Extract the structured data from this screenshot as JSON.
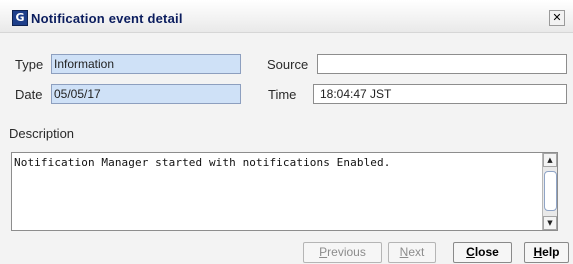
{
  "window": {
    "title": "Notification event detail",
    "title_icon_glyph": "G",
    "close_glyph": "✕"
  },
  "form": {
    "type_label": "Type",
    "type_value": "Information",
    "source_label": "Source",
    "source_value": "",
    "date_label": "Date",
    "date_value": "05/05/17",
    "time_label": "Time",
    "time_value": "18:04:47 JST"
  },
  "description": {
    "label": "Description",
    "text": "Notification Manager started with notifications Enabled."
  },
  "buttons": {
    "previous": {
      "mnemonic": "P",
      "rest": "revious",
      "enabled": false
    },
    "next": {
      "mnemonic": "N",
      "rest": "ext",
      "enabled": false
    },
    "close": {
      "mnemonic": "C",
      "rest": "lose",
      "enabled": true
    },
    "help": {
      "mnemonic": "H",
      "rest": "elp",
      "enabled": true
    }
  },
  "icons": {
    "title_icon": "app-icon",
    "close_icon": "close-icon",
    "scroll_up": "scroll-up-arrow-icon",
    "scroll_down": "scroll-down-arrow-icon"
  },
  "colors": {
    "readonly_field_bg": "#cfe1f7",
    "title_text": "#0b1d5e"
  }
}
